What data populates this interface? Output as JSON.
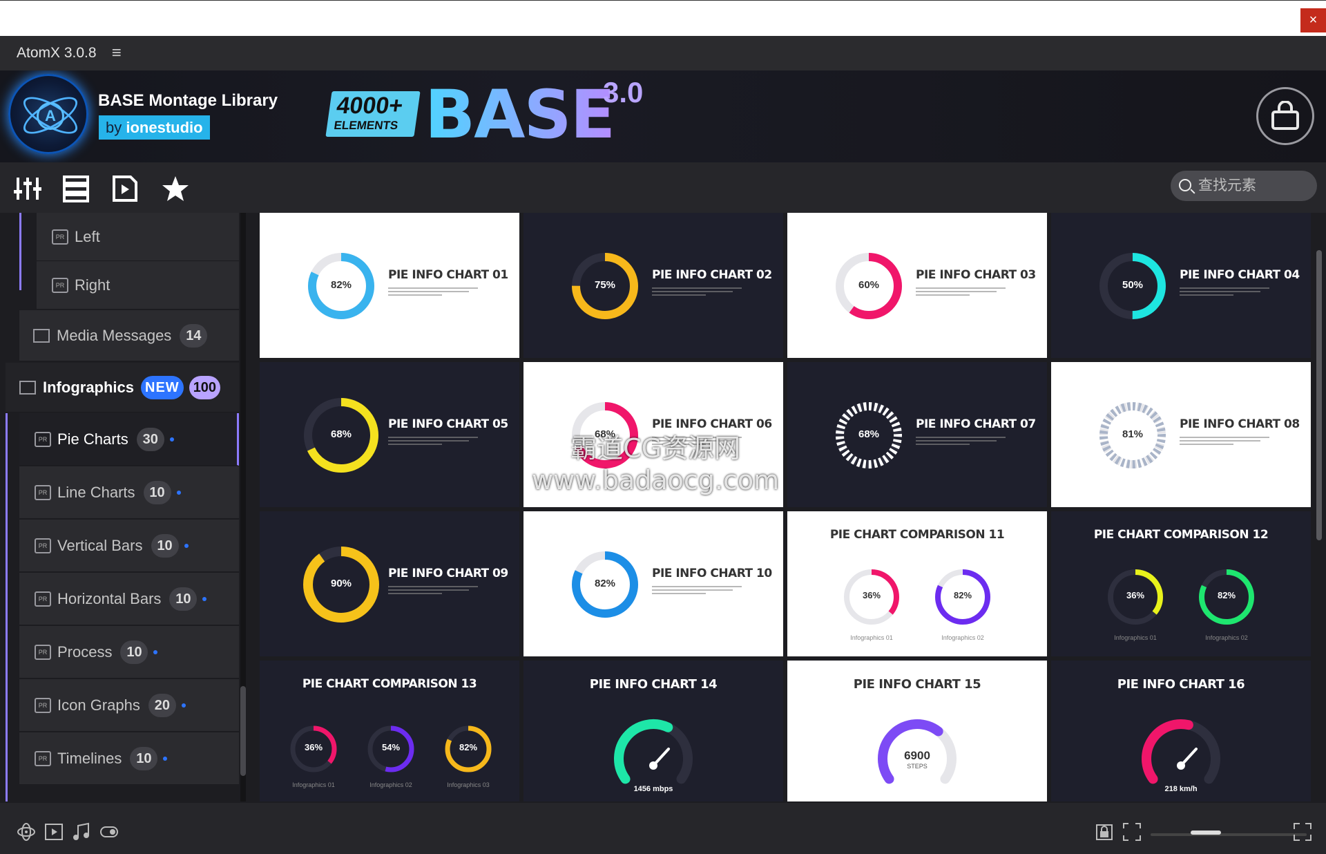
{
  "window": {
    "close_label": "×"
  },
  "app": {
    "title": "AtomX 3.0.8",
    "menu_glyph": "≡"
  },
  "banner": {
    "library_title": "BASE Montage Library",
    "by_prefix": "by ",
    "author": "ionestudio",
    "badge_count": "4000+",
    "badge_label": "ELEMENTS",
    "product": "BASE",
    "version": "3.0"
  },
  "toolbar": {
    "search_placeholder": "查找元素",
    "icons": [
      "sliders-icon",
      "list-icon",
      "play-file-icon",
      "star-icon"
    ]
  },
  "sidebar": {
    "subitems": [
      {
        "label": "Left"
      },
      {
        "label": "Right"
      }
    ],
    "media_messages": {
      "label": "Media Messages",
      "count": "14"
    },
    "infographics": {
      "label": "Infographics",
      "badge": "NEW",
      "count": "100"
    },
    "categories": [
      {
        "label": "Pie Charts",
        "count": "30"
      },
      {
        "label": "Line Charts",
        "count": "10"
      },
      {
        "label": "Vertical Bars",
        "count": "10"
      },
      {
        "label": "Horizontal Bars",
        "count": "10"
      },
      {
        "label": "Process",
        "count": "10"
      },
      {
        "label": "Icon Graphs",
        "count": "20"
      },
      {
        "label": "Timelines",
        "count": "10"
      }
    ]
  },
  "cards": [
    {
      "title": "PIE INFO CHART 01",
      "value": "82%",
      "theme": "light",
      "color": "#39b3ee",
      "pct": 0.82
    },
    {
      "title": "PIE INFO CHART 02",
      "value": "75%",
      "theme": "dark",
      "color": "#f7b81b",
      "pct": 0.75
    },
    {
      "title": "PIE INFO CHART 03",
      "value": "60%",
      "theme": "light",
      "color": "#f0166a",
      "pct": 0.6
    },
    {
      "title": "PIE INFO CHART 04",
      "value": "50%",
      "theme": "dark",
      "color": "#1ee5e0",
      "pct": 0.5
    },
    {
      "title": "PIE INFO CHART 05",
      "value": "68%",
      "theme": "dark",
      "color": "#f4e11f",
      "pct": 0.68
    },
    {
      "title": "PIE INFO CHART 06",
      "value": "68%",
      "theme": "light",
      "color": "#f0166a",
      "pct": 0.68
    },
    {
      "title": "PIE INFO CHART 07",
      "value": "68%",
      "theme": "dark",
      "color": "#ffffff",
      "pct": 0.68
    },
    {
      "title": "PIE INFO CHART 08",
      "value": "81%",
      "theme": "light",
      "color": "#a9b4c8",
      "pct": 0.81
    },
    {
      "title": "PIE INFO CHART 09",
      "value": "90%",
      "theme": "dark",
      "color": "#f6c21a",
      "pct": 0.9
    },
    {
      "title": "PIE INFO CHART 10",
      "value": "82%",
      "theme": "light",
      "color": "#1c8ee6",
      "pct": 0.82
    },
    {
      "title": "PIE CHART COMPARISON 11",
      "theme": "light",
      "pair": [
        {
          "value": "36%",
          "color": "#f0166a",
          "pct": 0.36,
          "label": "Infographics 01"
        },
        {
          "value": "82%",
          "color": "#6c2cf0",
          "pct": 0.82,
          "label": "Infographics 02"
        }
      ]
    },
    {
      "title": "PIE CHART COMPARISON 12",
      "theme": "dark",
      "pair": [
        {
          "value": "36%",
          "color": "#e8f21b",
          "pct": 0.36,
          "label": "Infographics 01"
        },
        {
          "value": "82%",
          "color": "#1ee66f",
          "pct": 0.82,
          "label": "Infographics 02"
        }
      ]
    },
    {
      "title": "PIE CHART COMPARISON 13",
      "theme": "dark",
      "triple": [
        {
          "value": "36%",
          "color": "#f0166a",
          "pct": 0.36,
          "label": "Infographics 01"
        },
        {
          "value": "54%",
          "color": "#6c2cf0",
          "pct": 0.54,
          "label": "Infographics 02"
        },
        {
          "value": "82%",
          "color": "#f6b81b",
          "pct": 0.82,
          "label": "Infographics 03"
        }
      ]
    },
    {
      "title": "PIE INFO CHART 14",
      "theme": "dark",
      "gauge": {
        "readout": "1456 mbps",
        "color": "#1ee6a8",
        "pct": 0.6
      }
    },
    {
      "title": "PIE INFO CHART 15",
      "theme": "light",
      "gauge": {
        "readout": "6900",
        "unit": "STEPS",
        "color": "#7d4bf5",
        "pct": 0.65
      }
    },
    {
      "title": "PIE INFO CHART 16",
      "theme": "dark",
      "gauge": {
        "readout": "218 km/h",
        "color": "#f0166a",
        "pct": 0.55
      }
    }
  ],
  "watermark": {
    "line1": "霸道CG资源网",
    "line2": "www.badaocg.com"
  }
}
